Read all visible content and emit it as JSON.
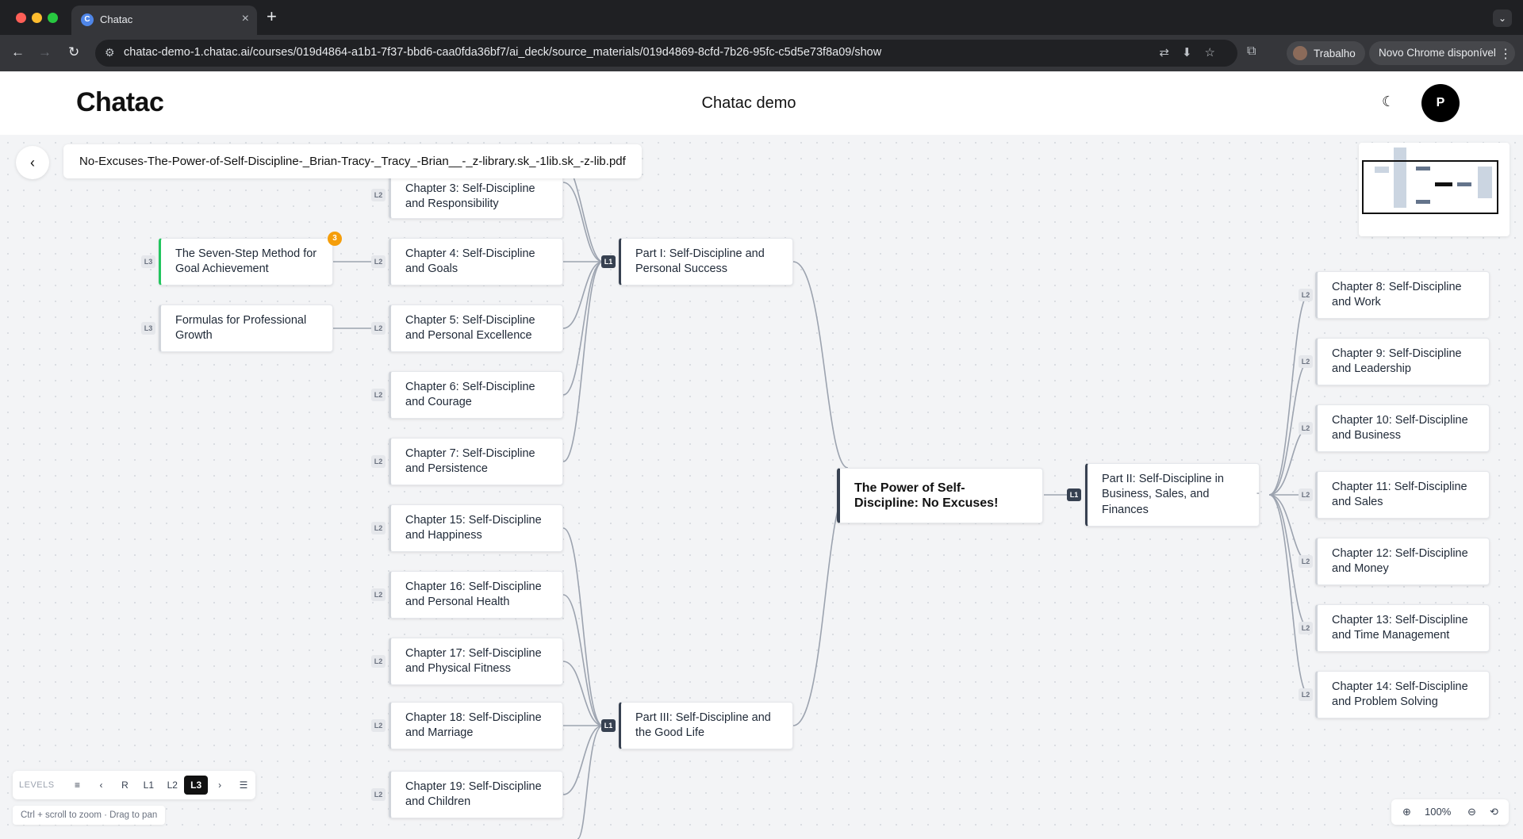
{
  "browser": {
    "tab_title": "Chatac",
    "new_tab": "+",
    "url": "chatac-demo-1.chatac.ai/courses/019d4864-a1b1-7f37-bbd6-caa0fda36bf7/ai_deck/source_materials/019d4869-8cfd-7b26-95fc-c5d5e73f8a09/show",
    "profile_label": "Trabalho",
    "update_label": "Novo Chrome disponível"
  },
  "app": {
    "logo": "Chatac",
    "title": "Chatac demo",
    "avatar_initial": "P"
  },
  "document": {
    "file_title": "No-Excuses-The-Power-of-Self-Discipline-_Brian-Tracy-_Tracy_-Brian__-_z-library.sk_-1lib.sk_-z-lib.pdf"
  },
  "mindmap": {
    "root": "The Power of Self-Discipline: No Excuses!",
    "part1": {
      "label": "Part I: Self-Discipline and Personal Success",
      "level": "L1"
    },
    "part2": {
      "label": "Part II: Self-Discipline in Business, Sales, and Finances",
      "level": "L1"
    },
    "part3": {
      "label": "Part III: Self-Discipline and the Good Life",
      "level": "L1"
    },
    "chapters": {
      "c3": "Chapter 3: Self-Discipline and Responsibility",
      "c4": "Chapter 4: Self-Discipline and Goals",
      "c5": "Chapter 5: Self-Discipline and Personal Excellence",
      "c6": "Chapter 6: Self-Discipline and Courage",
      "c7": "Chapter 7: Self-Discipline and Persistence",
      "c8": "Chapter 8: Self-Discipline and Work",
      "c9": "Chapter 9: Self-Discipline and Leadership",
      "c10": "Chapter 10: Self-Discipline and Business",
      "c11": "Chapter 11: Self-Discipline and Sales",
      "c12": "Chapter 12: Self-Discipline and Money",
      "c13": "Chapter 13: Self-Discipline and Time Management",
      "c14": "Chapter 14: Self-Discipline and Problem Solving",
      "c15": "Chapter 15: Self-Discipline and Happiness",
      "c16": "Chapter 16: Self-Discipline and Personal Health",
      "c17": "Chapter 17: Self-Discipline and Physical Fitness",
      "c18": "Chapter 18: Self-Discipline and Marriage",
      "c19": "Chapter 19: Self-Discipline and Children"
    },
    "leaves": {
      "seven_step": "The Seven-Step Method for Goal Achievement",
      "formulas": "Formulas for Professional Growth"
    },
    "seven_step_count": "3",
    "badge_l1": "L1",
    "badge_l2": "L2",
    "badge_l3": "L3",
    "collapse_toggle": "-"
  },
  "controls": {
    "levels_label": "LEVELS",
    "level_r": "R",
    "level_1": "L1",
    "level_2": "L2",
    "level_3": "L3",
    "active_level": "L3",
    "hint": "Ctrl + scroll to zoom · Drag to pan",
    "zoom": "100%"
  },
  "colors": {
    "selected_accent": "#22c55e",
    "count_badge": "#f59e0b",
    "edge": "#9ca3af"
  }
}
